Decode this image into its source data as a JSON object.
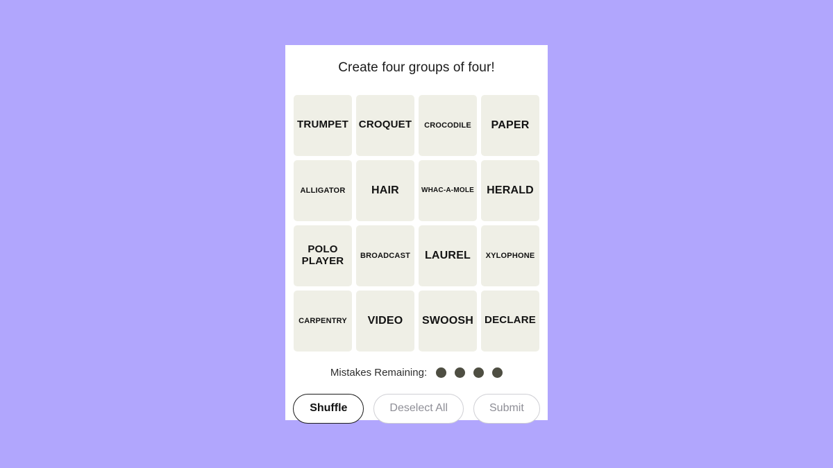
{
  "theme": {
    "page_background": "#b1a6fd",
    "card_background": "#ffffff",
    "tile_background": "#efefe6",
    "tile_text": "#121212",
    "mistake_dot": "#4e4e42",
    "muted_text": "#8e8e96"
  },
  "header": {
    "title": "Create four groups of four!"
  },
  "grid": {
    "rows": 4,
    "columns": 4,
    "tiles": [
      {
        "label": "TRUMPET",
        "size": "fs-lg"
      },
      {
        "label": "CROQUET",
        "size": "fs-lg"
      },
      {
        "label": "CROCODILE",
        "size": "fs-sm"
      },
      {
        "label": "PAPER",
        "size": "fs-xl"
      },
      {
        "label": "ALLIGATOR",
        "size": "fs-sm"
      },
      {
        "label": "HAIR",
        "size": "fs-xl"
      },
      {
        "label": "WHAC-A-MOLE",
        "size": "fs-xs"
      },
      {
        "label": "HERALD",
        "size": "fs-xl"
      },
      {
        "label": "POLO\nPLAYER",
        "size": "fs-lg"
      },
      {
        "label": "BROADCAST",
        "size": "fs-sm"
      },
      {
        "label": "LAUREL",
        "size": "fs-xl"
      },
      {
        "label": "XYLOPHONE",
        "size": "fs-sm"
      },
      {
        "label": "CARPENTRY",
        "size": "fs-sm"
      },
      {
        "label": "VIDEO",
        "size": "fs-xl"
      },
      {
        "label": "SWOOSH",
        "size": "fs-xl"
      },
      {
        "label": "DECLARE",
        "size": "fs-lg"
      }
    ]
  },
  "mistakes": {
    "label": "Mistakes Remaining:",
    "remaining": 4,
    "dots": [
      1,
      2,
      3,
      4
    ]
  },
  "controls": {
    "shuffle_label": "Shuffle",
    "deselect_label": "Deselect All",
    "submit_label": "Submit"
  }
}
